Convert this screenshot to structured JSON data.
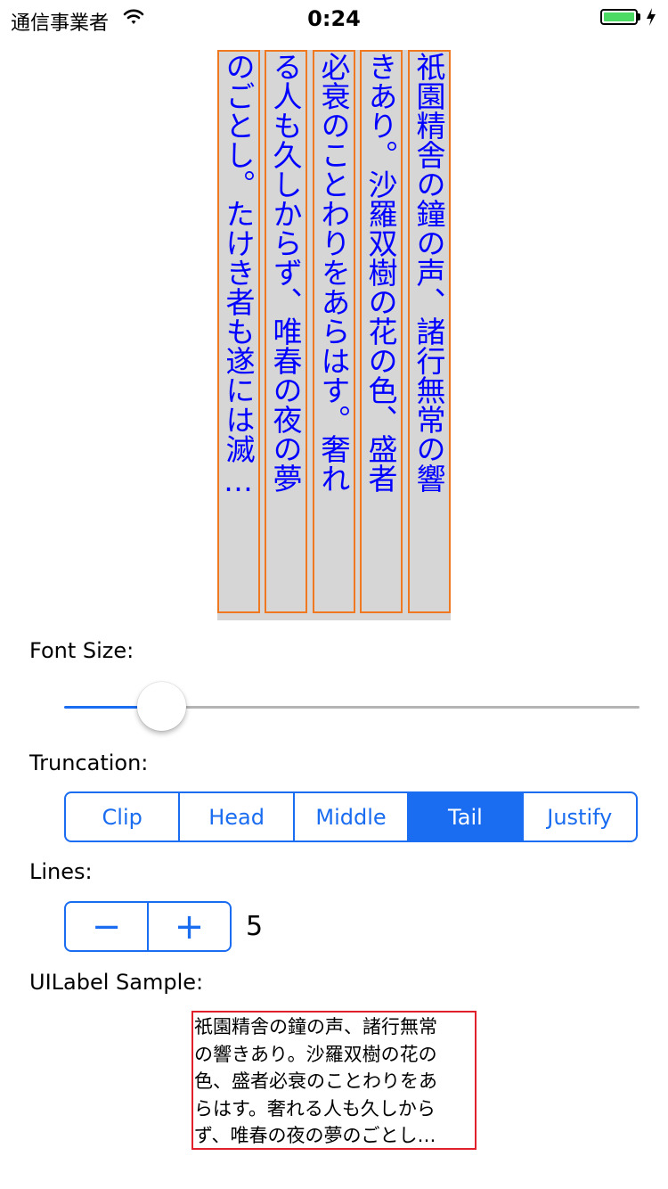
{
  "status_bar": {
    "carrier": "通信事業者",
    "time": "0:24",
    "battery_level": 1.0,
    "battery_color": "#4cd964"
  },
  "vertical_text": {
    "columns": [
      "祇園精舎の鐘の声、諸行無常の響",
      "きあり。沙羅双樹の花の色、盛者",
      "必衰のことわりをあらはす。奢れ",
      "る人も久しからず、唯春の夜の夢",
      "のごとし。たけき者も遂には滅…"
    ],
    "text_color": "#0000ff",
    "border_color": "#f07820",
    "background": "#d6d6d6"
  },
  "font_size": {
    "label": "Font Size:",
    "value": 0.17
  },
  "truncation": {
    "label": "Truncation:",
    "options": [
      "Clip",
      "Head",
      "Middle",
      "Tail",
      "Justify"
    ],
    "selected": "Tail"
  },
  "lines": {
    "label": "Lines:",
    "minus_symbol": "−",
    "plus_symbol": "+",
    "value": "5"
  },
  "uilabel": {
    "label": "UILabel Sample:",
    "lines": [
      "祇園精舎の鐘の声、諸行無常",
      "の響きあり。沙羅双樹の花の",
      "色、盛者必衰のことわりをあ",
      "らはす。奢れる人も久しから",
      "ず、唯春の夜の夢のごとし…"
    ]
  },
  "colors": {
    "accent": "#1a6cf0",
    "sample_border": "#e0202a"
  }
}
